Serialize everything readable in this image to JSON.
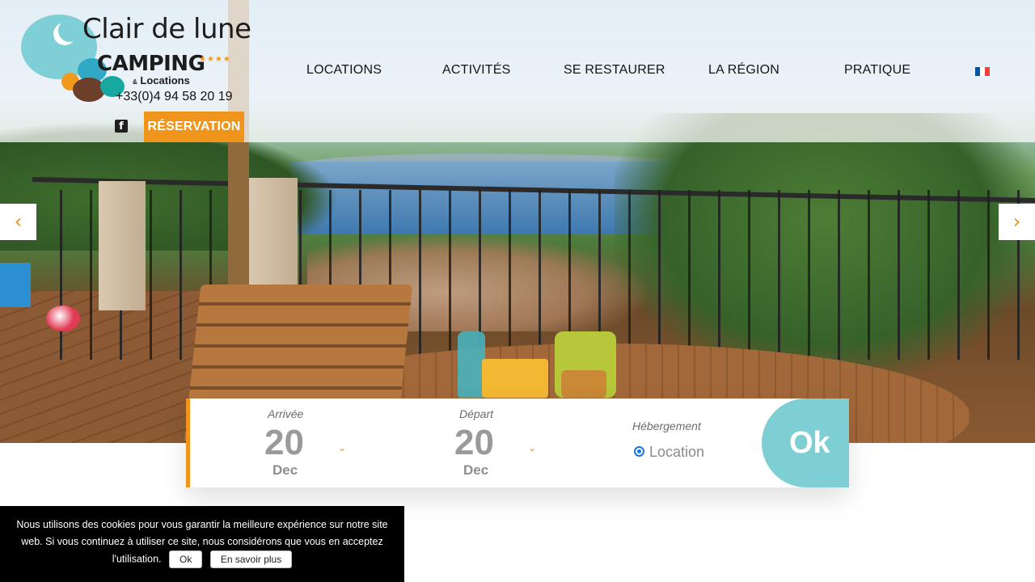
{
  "brand": {
    "name_line1": "Clair de lune",
    "name_line2": "CAMPING",
    "stars": "★★★★",
    "name_line3_amp": "&",
    "name_line3": "Locations"
  },
  "header": {
    "phone": "+33(0)4 94 58 20 19",
    "reservation_label": "RÉSERVATION",
    "facebook_icon": "facebook-icon",
    "facebook_glyph": "f"
  },
  "nav": {
    "items": [
      {
        "label": "LOCATIONS"
      },
      {
        "label": "ACTIVITÉS"
      },
      {
        "label": "SE RESTAURER"
      },
      {
        "label": "LA RÉGION"
      },
      {
        "label": "PRATIQUE"
      }
    ],
    "language_flag": "french-flag-icon"
  },
  "slider": {
    "prev_glyph": "‹",
    "next_glyph": "›"
  },
  "booking": {
    "arrival_label": "Arrivée",
    "arrival_day": "20",
    "arrival_month": "Dec",
    "departure_label": "Départ",
    "departure_day": "20",
    "departure_month": "Dec",
    "chevron_glyph": "⌄",
    "accommodation_label": "Hébergement",
    "accommodation_option": "Location",
    "submit_label": "Ok"
  },
  "cookie": {
    "message": "Nous utilisons des cookies pour vous garantir la meilleure expérience sur notre site web. Si vous continuez à utiliser ce site, nous considérons que vous en acceptez l'utilisation.",
    "accept_label": "Ok",
    "more_label": "En savoir plus"
  },
  "colors": {
    "accent_orange": "#f0951c",
    "ok_teal": "#7ecfd4",
    "logo_teal": "#7fcfd6",
    "flag_blue": "#0055a4",
    "flag_white": "#ffffff",
    "flag_red": "#ef4135"
  }
}
